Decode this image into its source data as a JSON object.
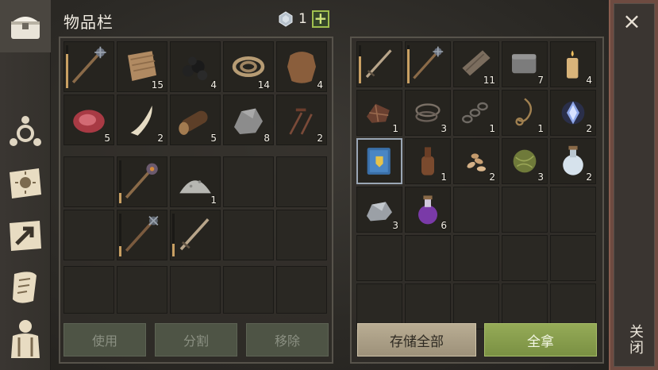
{
  "header": {
    "title": "物品栏",
    "gem_count": "1",
    "plus_label": "+"
  },
  "sidebar": {
    "items": [
      {
        "name": "chest-icon"
      },
      {
        "name": "skills-icon"
      },
      {
        "name": "sun-map-icon"
      },
      {
        "name": "arrow-map-icon"
      },
      {
        "name": "scroll-icon"
      },
      {
        "name": "character-icon"
      }
    ]
  },
  "inventory": {
    "row1": [
      {
        "item": "mace-icon",
        "count": "",
        "durability": 0.8
      },
      {
        "item": "fabric-icon",
        "count": "15"
      },
      {
        "item": "coal-icon",
        "count": "4"
      },
      {
        "item": "rope-icon",
        "count": "14"
      },
      {
        "item": "leather-icon",
        "count": "4"
      }
    ],
    "row2": [
      {
        "item": "raw-meat-icon",
        "count": "5"
      },
      {
        "item": "fang-icon",
        "count": "2"
      },
      {
        "item": "log-icon",
        "count": "5"
      },
      {
        "item": "stone-icon",
        "count": "8"
      },
      {
        "item": "nails-icon",
        "count": "2"
      }
    ]
  },
  "equip": {
    "row1": [
      {
        "item": "",
        "count": ""
      },
      {
        "item": "morningstar-icon",
        "count": "",
        "durability": 0.25
      },
      {
        "item": "ore-dust-icon",
        "count": "1"
      },
      {
        "item": "",
        "count": ""
      },
      {
        "item": "",
        "count": ""
      }
    ],
    "row2": [
      {
        "item": "",
        "count": ""
      },
      {
        "item": "spiked-mace-icon",
        "count": "",
        "durability": 0.25
      },
      {
        "item": "sword-icon",
        "count": "",
        "durability": 0.3
      },
      {
        "item": "",
        "count": ""
      },
      {
        "item": "",
        "count": ""
      }
    ]
  },
  "storage": {
    "items": [
      {
        "item": "sword-icon",
        "count": "",
        "durability": 0.7
      },
      {
        "item": "mace-icon",
        "count": "",
        "durability": 0.9
      },
      {
        "item": "plank-icon",
        "count": "11"
      },
      {
        "item": "stone-block-icon",
        "count": "7"
      },
      {
        "item": "candle-icon",
        "count": "4"
      },
      {
        "item": "scrap-icon",
        "count": "1"
      },
      {
        "item": "wire-icon",
        "count": "3"
      },
      {
        "item": "chain-icon",
        "count": "1"
      },
      {
        "item": "noose-icon",
        "count": "1"
      },
      {
        "item": "crystal-icon",
        "count": "2"
      },
      {
        "item": "book-icon",
        "count": "",
        "selected": true
      },
      {
        "item": "bottle-icon",
        "count": "1"
      },
      {
        "item": "seeds-icon",
        "count": "2"
      },
      {
        "item": "herb-ball-icon",
        "count": "3"
      },
      {
        "item": "potion-white-icon",
        "count": "2"
      },
      {
        "item": "iron-ore-icon",
        "count": "3"
      },
      {
        "item": "potion-purple-icon",
        "count": "6"
      }
    ]
  },
  "buttons": {
    "use": "使用",
    "split": "分割",
    "remove": "移除",
    "store_all": "存储全部",
    "take_all": "全拿"
  },
  "close": {
    "x": "×",
    "label": "关闭"
  },
  "colors": {
    "accent_green": "#95ab57",
    "close_bar": "#6e4b41",
    "durability": "#c9a063"
  }
}
